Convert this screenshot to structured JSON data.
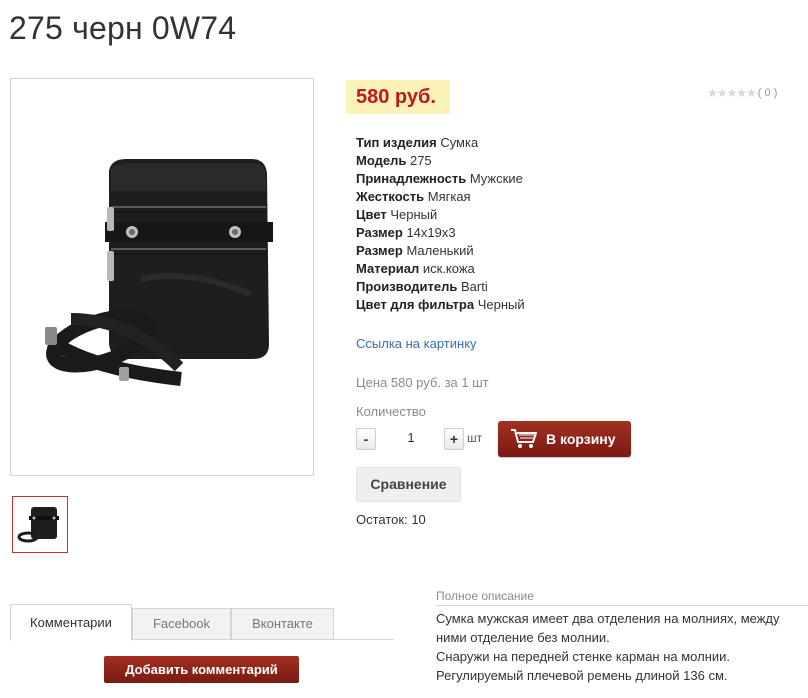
{
  "product": {
    "title": "275 черн 0W74",
    "price": "580 руб.",
    "rating": {
      "stars": 0,
      "count": "( 0 )"
    },
    "properties": [
      {
        "label": "Тип изделия",
        "value": "Сумка"
      },
      {
        "label": "Модель",
        "value": "275"
      },
      {
        "label": "Принадлежность",
        "value": "Мужские"
      },
      {
        "label": "Жесткость",
        "value": "Мягкая"
      },
      {
        "label": "Цвет",
        "value": "Черный"
      },
      {
        "label": "Размер",
        "value": "14x19x3"
      },
      {
        "label": "Размер",
        "value": "Маленький"
      },
      {
        "label": "Материал",
        "value": "иск.кожа"
      },
      {
        "label": "Производитель",
        "value": "Barti"
      },
      {
        "label": "Цвет для фильтра",
        "value": "Черный"
      }
    ],
    "image_link": "Ссылка на картинку",
    "unit_price": "Цена 580 руб. за 1 шт",
    "quantity": {
      "label": "Количество",
      "minus": "-",
      "value": "1",
      "plus": "+",
      "unit": "шт"
    },
    "cart_button": "В корзину",
    "compare_button": "Сравнение",
    "stock": "Остаток: 10"
  },
  "tabs": [
    {
      "label": "Комментарии",
      "active": true
    },
    {
      "label": "Facebook",
      "active": false
    },
    {
      "label": "Вконтакте",
      "active": false
    }
  ],
  "add_comment_button": "Добавить комментарий",
  "description": {
    "title": "Полное описание",
    "lines": [
      "Сумка мужская имеет два отделения на молниях, между ними отделение без молнии.",
      "Снаружи на передней стенке карман на молнии.",
      "Регулируемый плечевой  ремень длиной 136 см."
    ]
  },
  "colors": {
    "price_bg": "#fbf3b7",
    "price_text": "#c4161c",
    "primary_button": "#8f2519",
    "link": "#3b6fa8"
  },
  "icons": {
    "cart": "shopping-cart-icon",
    "star": "star-icon"
  }
}
